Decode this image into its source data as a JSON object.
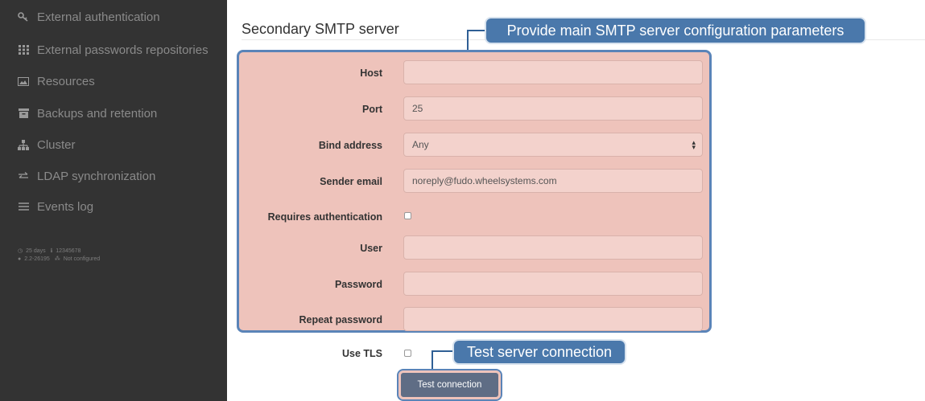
{
  "sidebar": {
    "items": [
      {
        "label": "External authentication",
        "icon": "key-icon"
      },
      {
        "label": "External passwords repositories",
        "icon": "grid-icon"
      },
      {
        "label": "Resources",
        "icon": "image-icon"
      },
      {
        "label": "Backups and retention",
        "icon": "archive-icon"
      },
      {
        "label": "Cluster",
        "icon": "cluster-icon"
      },
      {
        "label": "LDAP synchronization",
        "icon": "sync-arrows-icon"
      },
      {
        "label": "Events log",
        "icon": "list-icon"
      }
    ],
    "sys_uptime": "25 days",
    "sys_serial": "12345678",
    "sys_version": "2.2-26195",
    "sys_cluster": "Not configured"
  },
  "section": {
    "title": "Secondary SMTP server"
  },
  "callouts": {
    "main": "Provide main SMTP server configuration parameters",
    "test": "Test server connection"
  },
  "form": {
    "host_label": "Host",
    "host_value": "",
    "port_label": "Port",
    "port_value": "25",
    "bind_label": "Bind address",
    "bind_value": "Any",
    "sender_label": "Sender email",
    "sender_value": "noreply@fudo.wheelsystems.com",
    "auth_label": "Requires authentication",
    "user_label": "User",
    "user_value": "",
    "password_label": "Password",
    "password_value": "",
    "repeat_label": "Repeat password",
    "repeat_value": "",
    "tls_label": "Use TLS",
    "test_button": "Test connection"
  },
  "colors": {
    "sidebar_bg": "#333333",
    "highlight_fill": "#eec3bb",
    "highlight_border": "#5a84b8",
    "callout_bg": "#4a78ab"
  }
}
